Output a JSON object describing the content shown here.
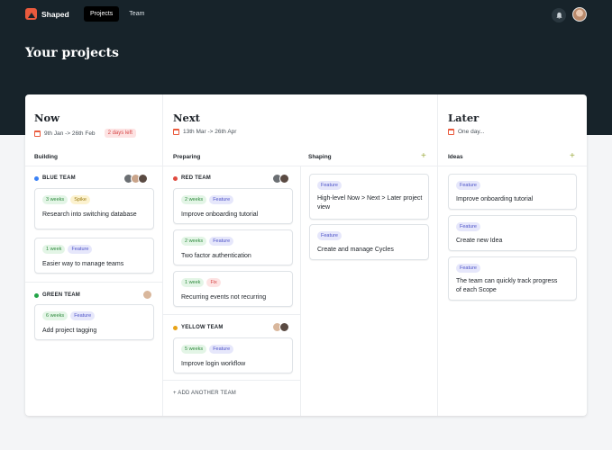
{
  "app": {
    "name": "Shaped"
  },
  "nav": {
    "items": [
      {
        "label": "Projects",
        "active": true
      },
      {
        "label": "Team",
        "active": false
      }
    ]
  },
  "page": {
    "title": "Your projects"
  },
  "columns": {
    "now": {
      "title": "Now",
      "dates": "9th Jan -> 26th Feb",
      "badge": "2 days left",
      "lane": "Building",
      "teams": [
        {
          "name": "BLUE TEAM",
          "color": "#3b82f6",
          "cards": [
            {
              "tags": [
                "3 weeks",
                "Spike"
              ],
              "text": "Research into switching database"
            },
            {
              "tags": [
                "1 week",
                "Feature"
              ],
              "text": "Easier way to manage teams"
            }
          ]
        },
        {
          "name": "GREEN TEAM",
          "color": "#22a447",
          "cards": [
            {
              "tags": [
                "6 weeks",
                "Feature"
              ],
              "text": "Add project tagging"
            }
          ]
        }
      ]
    },
    "next": {
      "title": "Next",
      "dates": "13th Mar -> 26th Apr",
      "lanes": {
        "preparing": "Preparing",
        "shaping": "Shaping"
      },
      "teams": [
        {
          "name": "RED TEAM",
          "color": "#e04a3f",
          "cards": [
            {
              "tags": [
                "2 weeks",
                "Feature"
              ],
              "text": "Improve onboarding tutorial"
            },
            {
              "tags": [
                "2 weeks",
                "Feature"
              ],
              "text": "Two factor authentication"
            },
            {
              "tags": [
                "1 week",
                "Fix"
              ],
              "text": "Recurring events not recurring"
            }
          ]
        },
        {
          "name": "YELLOW TEAM",
          "color": "#e8a317",
          "cards": [
            {
              "tags": [
                "5 weeks",
                "Feature"
              ],
              "text": "Improve login workflow"
            }
          ]
        }
      ],
      "add_team": "+ ADD ANOTHER TEAM",
      "shaping_cards": [
        {
          "tag": "Feature",
          "text": "High-level Now > Next > Later project view"
        },
        {
          "tag": "Feature",
          "text": "Create and manage Cycles"
        }
      ]
    },
    "later": {
      "title": "Later",
      "dates": "One day...",
      "lane": "Ideas",
      "cards": [
        {
          "tag": "Feature",
          "text": "Improve onboarding tutorial"
        },
        {
          "tag": "Feature",
          "text": "Create new Idea"
        },
        {
          "tag": "Feature",
          "text": "The team can quickly track progress of each Scope"
        }
      ]
    }
  },
  "icons": {
    "bell": "bell-icon",
    "calendar": "calendar-icon",
    "plus": "+"
  },
  "colors": {
    "hero": "#17232a",
    "accent": "#ea5a3d"
  }
}
